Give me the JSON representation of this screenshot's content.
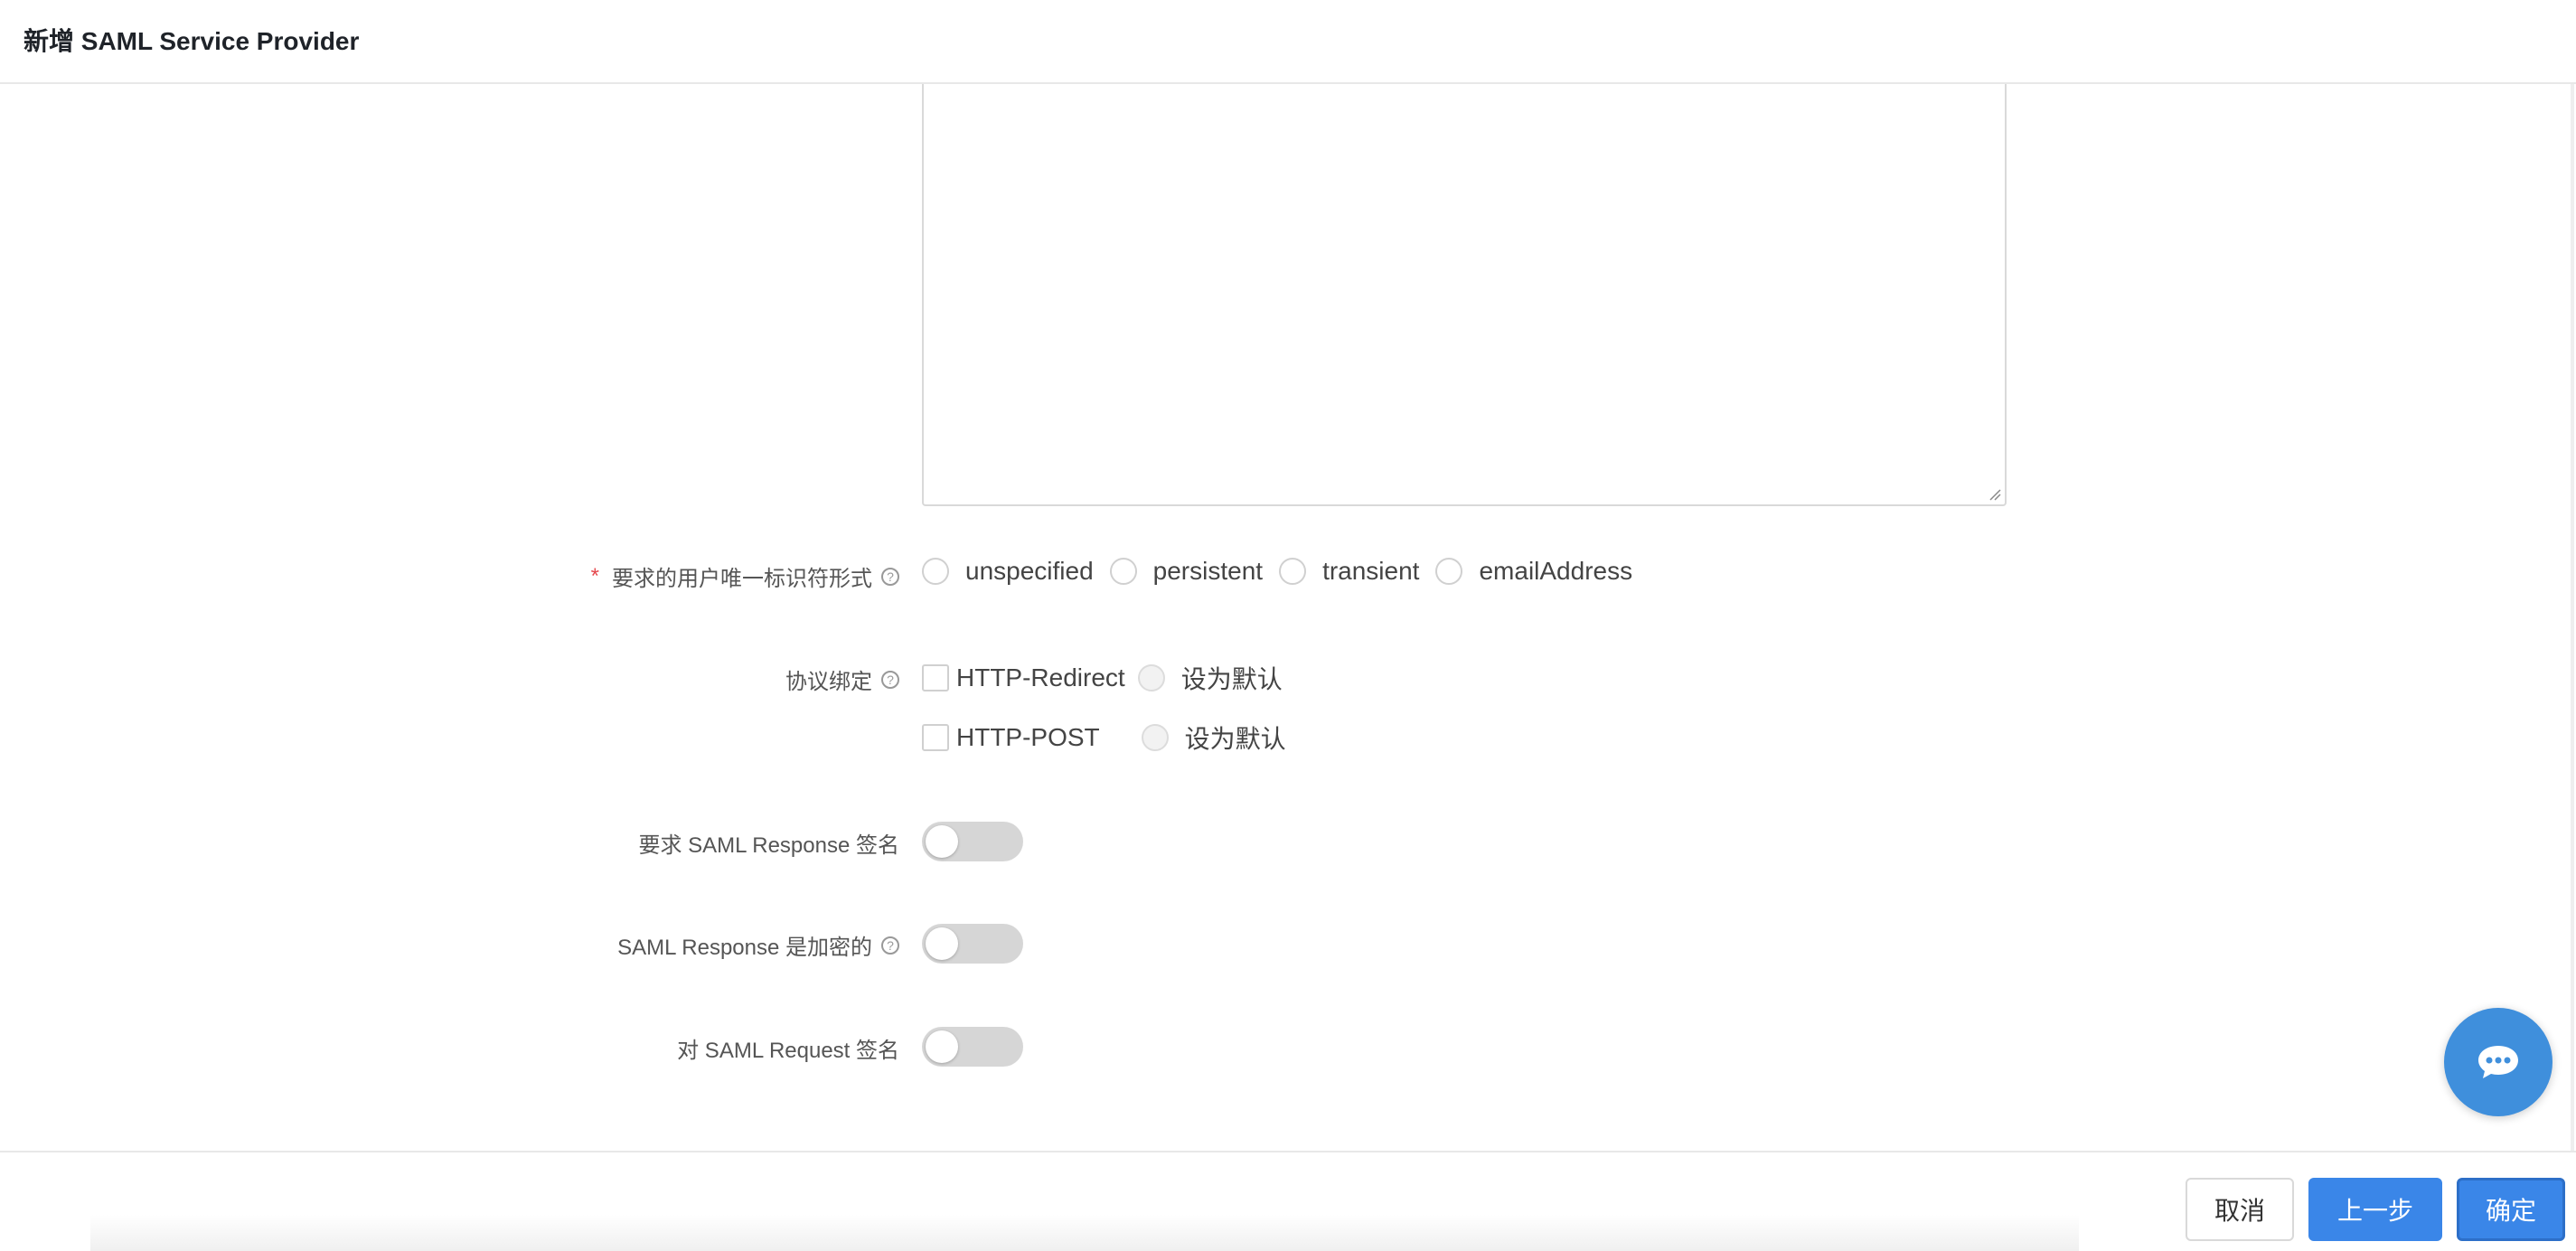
{
  "header": {
    "title": "新增 SAML Service Provider"
  },
  "form": {
    "name_id_format": {
      "label": "要求的用户唯一标识符形式",
      "required_mark": "*",
      "help": "?",
      "options": [
        "unspecified",
        "persistent",
        "transient",
        "emailAddress"
      ]
    },
    "binding": {
      "label": "协议绑定",
      "help": "?",
      "items": [
        {
          "label": "HTTP-Redirect",
          "default_label": "设为默认"
        },
        {
          "label": "HTTP-POST",
          "default_label": "设为默认"
        }
      ]
    },
    "require_response_signed": {
      "label": "要求 SAML Response 签名",
      "enabled": false
    },
    "response_encrypted": {
      "label": "SAML Response 是加密的",
      "help": "?",
      "enabled": false
    },
    "sign_request": {
      "label": "对 SAML Request 签名",
      "enabled": false
    }
  },
  "footer": {
    "cancel_label": "取消",
    "prev_label": "上一步",
    "ok_label": "确定"
  },
  "colors": {
    "primary": "#3a86e8",
    "required": "#e5484d",
    "chat": "#3f8fdc"
  },
  "icons": {
    "chat": "chat-bubble-icon",
    "help": "question-circle-icon"
  }
}
